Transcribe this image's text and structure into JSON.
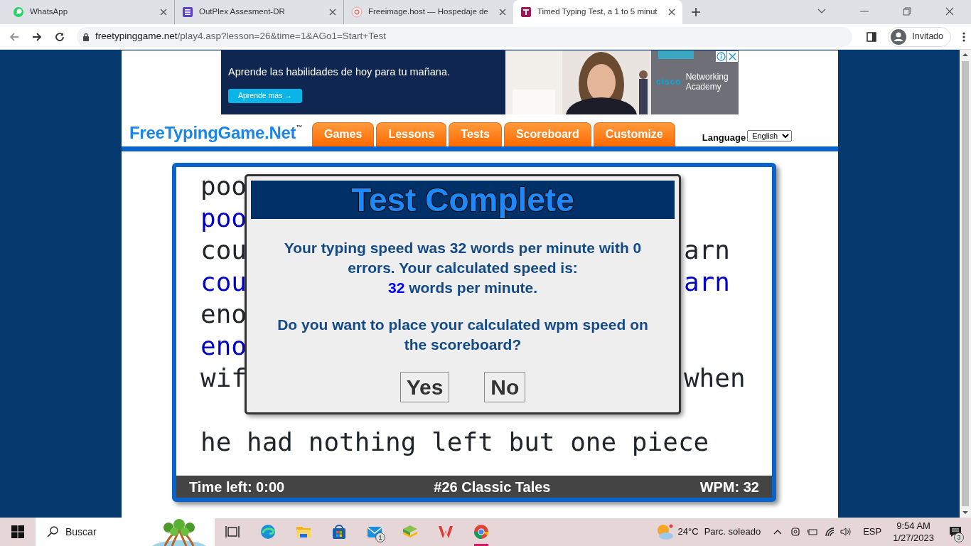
{
  "browser": {
    "tabs": [
      {
        "title": "WhatsApp",
        "selected": false
      },
      {
        "title": "OutPlex Assesment-DR",
        "selected": false
      },
      {
        "title": "Freeimage.host — Hospedaje de",
        "selected": false
      },
      {
        "title": "Timed Typing Test, a 1 to 5 minut",
        "selected": true
      }
    ],
    "url_host": "freetypinggame.net",
    "url_path": "/play4.asp?lesson=26&time=1&AGo1=Start+Test",
    "profile": "Invitado"
  },
  "ad": {
    "headline": "Aprende las habilidades de hoy para tu mañana.",
    "button": "Aprende más →",
    "brand": "cisco",
    "product": "Networking Academy"
  },
  "site": {
    "logo": "FreeTypingGame.Net$^{™}$",
    "nav": [
      "Games",
      "Lessons",
      "Tests",
      "Scoreboard",
      "Customize"
    ],
    "language_label": "Language",
    "language_value": "English"
  },
  "typing": {
    "lines": [
      {
        "kind": "text",
        "left": "poo",
        "typed": false
      },
      {
        "kind": "text",
        "left": "poo",
        "typed": true
      },
      {
        "kind": "text",
        "left": "cou",
        "right": "arn",
        "typed": false
      },
      {
        "kind": "text",
        "left": "cou",
        "right": "arn",
        "typed": true
      },
      {
        "kind": "text",
        "left": "eno",
        "typed": false
      },
      {
        "kind": "text",
        "left": "eno",
        "typed": true
      },
      {
        "kind": "text",
        "left": "wif",
        "right": "when",
        "typed": false
      },
      {
        "kind": "blank"
      },
      {
        "kind": "text",
        "left": "he had nothing left but one piece",
        "typed": false
      }
    ],
    "time_left": "Time left: 0:00",
    "lesson": "#26 Classic Tales",
    "wpm": "WPM: 32"
  },
  "dialog": {
    "title": "Test Complete",
    "message": "Your typing speed was 32 words per minute with 0 errors. Your calculated speed is:",
    "speed_value": "32",
    "speed_unit": "words per minute.",
    "question": "Do you want to place your calculated wpm speed on the scoreboard?",
    "buttons": [
      "Yes",
      "No"
    ]
  },
  "taskbar": {
    "search_placeholder": "Buscar",
    "apps": [
      {
        "selected": false
      },
      {
        "selected": false
      },
      {
        "selected": false
      },
      {
        "selected": false
      },
      {
        "selected": false,
        "badge": "1"
      },
      {
        "selected": false
      },
      {
        "selected": false
      },
      {
        "selected": true
      }
    ],
    "temperature": "24°C",
    "weather": "Parc. soleado",
    "language": "ESP",
    "time": "9:54 AM",
    "date": "1/27/2023",
    "notifications": "3"
  }
}
